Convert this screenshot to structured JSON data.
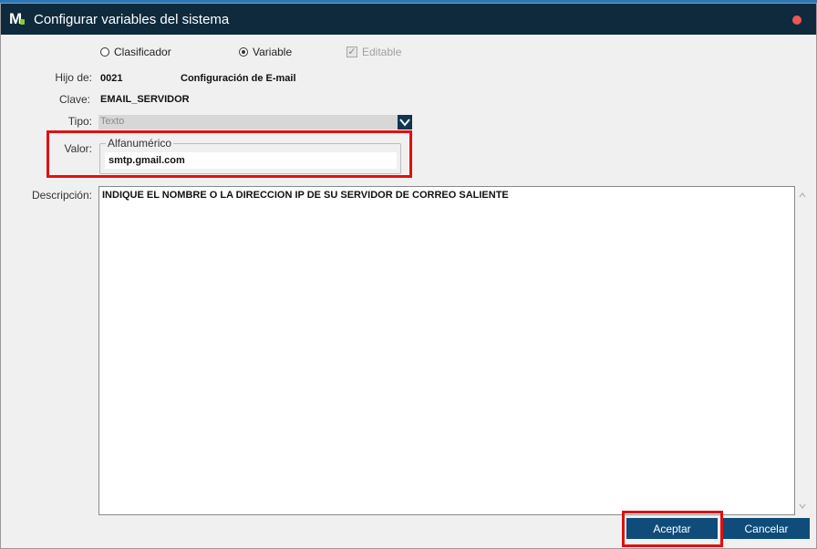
{
  "window": {
    "title": "Configurar variables del sistema",
    "logo_letter": "M"
  },
  "mode": {
    "clasificador_label": "Clasificador",
    "variable_label": "Variable",
    "selected": "variable",
    "editable_label": "Editable",
    "editable_checked": true
  },
  "form": {
    "hijo_de_label": "Hijo de:",
    "hijo_de_code": "0021",
    "hijo_de_name": "Configuración de E-mail",
    "clave_label": "Clave:",
    "clave_value": "EMAIL_SERVIDOR",
    "tipo_label": "Tipo:",
    "tipo_value": "Texto",
    "valor_label": "Valor:",
    "valor_group": "Alfanumérico",
    "valor_value": "smtp.gmail.com",
    "descripcion_label": "Descripción:",
    "descripcion_value": "INDIQUE EL NOMBRE O LA DIRECCION IP DE SU SERVIDOR DE CORREO SALIENTE"
  },
  "buttons": {
    "accept_label": "Aceptar",
    "cancel_label": "Cancelar"
  },
  "colors": {
    "titlebar": "#0f2a3d",
    "button": "#0f4c7a",
    "highlight": "#e01010"
  }
}
